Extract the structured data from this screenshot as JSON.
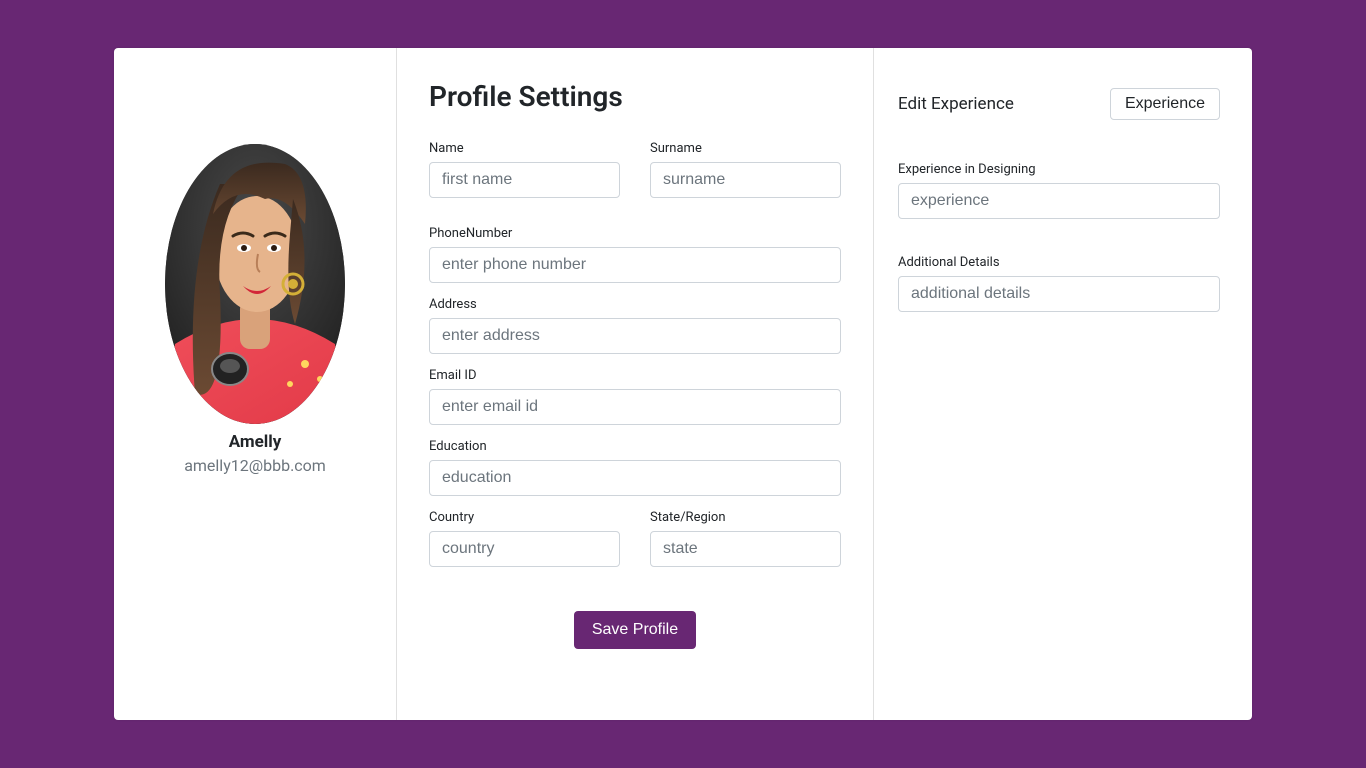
{
  "profile": {
    "name": "Amelly",
    "email": "amelly12@bbb.com"
  },
  "settings": {
    "title": "Profile Settings",
    "labels": {
      "name": "Name",
      "surname": "Surname",
      "phone": "PhoneNumber",
      "address": "Address",
      "email": "Email ID",
      "education": "Education",
      "country": "Country",
      "state": "State/Region"
    },
    "placeholders": {
      "name": "first name",
      "surname": "surname",
      "phone": "enter phone number",
      "address": "enter address",
      "email": "enter email id",
      "education": "education",
      "country": "country",
      "state": "state"
    },
    "save_label": "Save Profile"
  },
  "experience": {
    "heading": "Edit Experience",
    "button_label": "Experience",
    "labels": {
      "designing": "Experience in Designing",
      "details": "Additional Details"
    },
    "placeholders": {
      "designing": "experience",
      "details": "additional details"
    }
  }
}
